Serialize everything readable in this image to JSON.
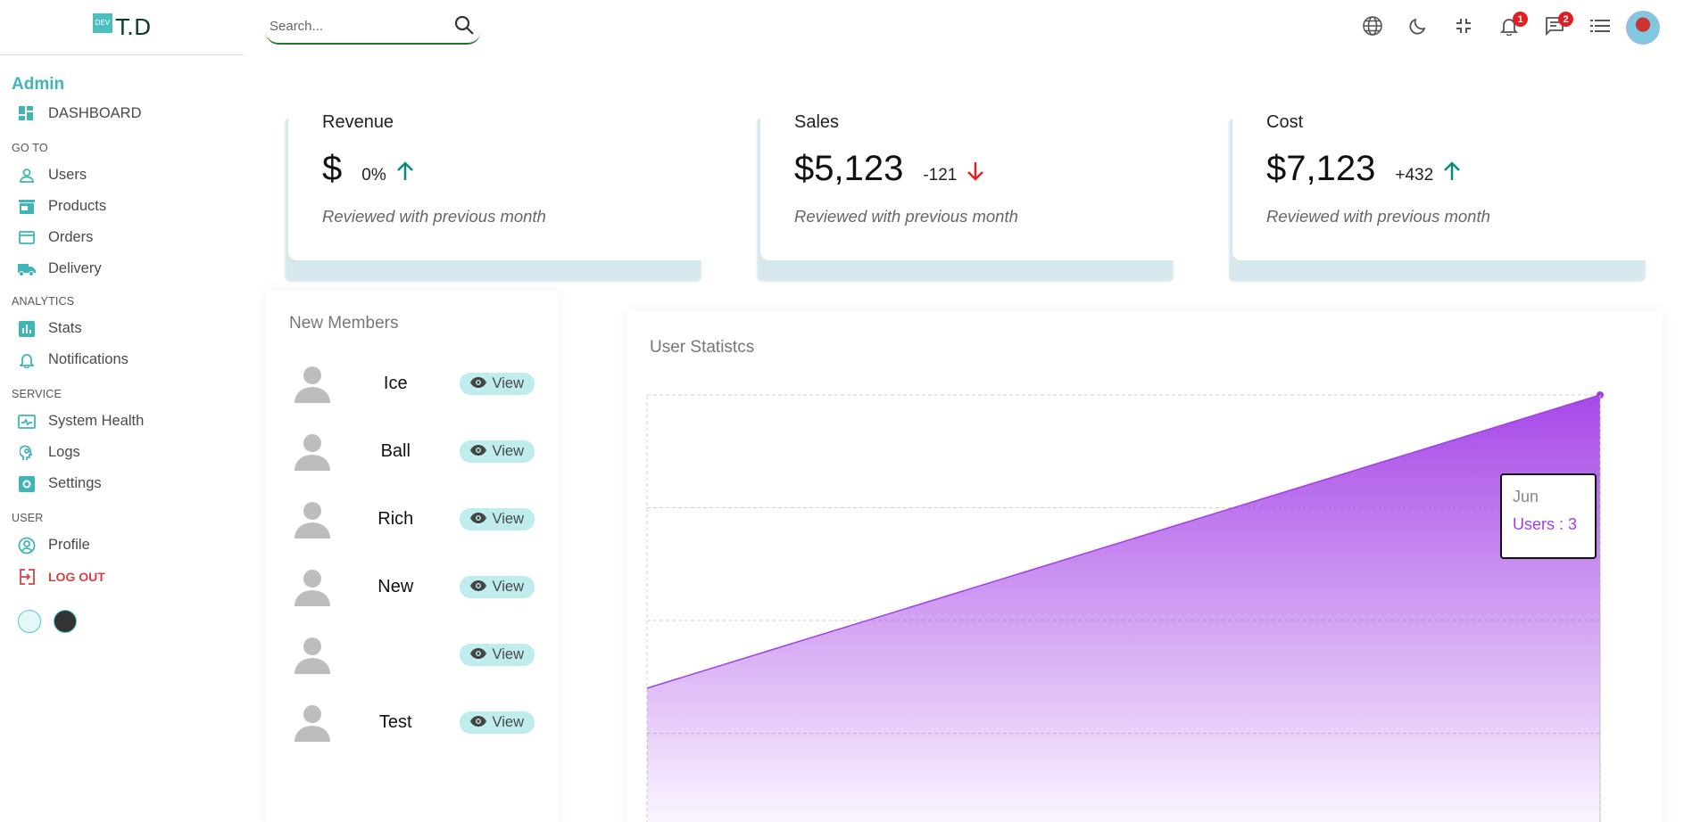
{
  "brand": {
    "logo": "DEV",
    "name": "T.D"
  },
  "sidebar": {
    "role": "Admin",
    "dashboard": "DASHBOARD",
    "sections": {
      "goto": "GO TO",
      "analytics": "ANALYTICS",
      "service": "SERVICE",
      "user": "USER"
    },
    "items": {
      "users": "Users",
      "products": "Products",
      "orders": "Orders",
      "delivery": "Delivery",
      "stats": "Stats",
      "notifications": "Notifications",
      "system_health": "System Health",
      "logs": "Logs",
      "settings": "Settings",
      "profile": "Profile",
      "logout": "LOG OUT"
    },
    "accent_color": "#3fb5b8"
  },
  "search": {
    "placeholder": "Search..."
  },
  "topbar": {
    "icons": [
      "globe-icon",
      "moon-icon",
      "compress-icon",
      "bell-icon",
      "chat-icon",
      "list-icon"
    ],
    "notifications_count": "1",
    "messages_count": "2"
  },
  "stats": [
    {
      "title": "Revenue",
      "value": "$",
      "change": "0%",
      "direction": "up",
      "subtitle": "Reviewed with previous month"
    },
    {
      "title": "Sales",
      "value": "$5,123",
      "change": "-121",
      "direction": "down",
      "subtitle": "Reviewed with previous month"
    },
    {
      "title": "Cost",
      "value": "$7,123",
      "change": "+432",
      "direction": "up",
      "subtitle": "Reviewed with previous month"
    }
  ],
  "members": {
    "title": "New Members",
    "view_label": "View",
    "list": [
      "Ice",
      "Ball",
      "Rich",
      "New",
      "",
      "Test"
    ]
  },
  "chart": {
    "title": "User Statistcs",
    "tooltip": {
      "x": "Jun",
      "y": "Users : 3"
    }
  },
  "chart_data": {
    "type": "area",
    "x": [
      "",
      "Jun"
    ],
    "series": [
      {
        "name": "Users",
        "values": [
          0.4,
          3
        ]
      }
    ],
    "ylim": [
      -1,
      3
    ],
    "grid": true,
    "color": "#a23ee6"
  }
}
